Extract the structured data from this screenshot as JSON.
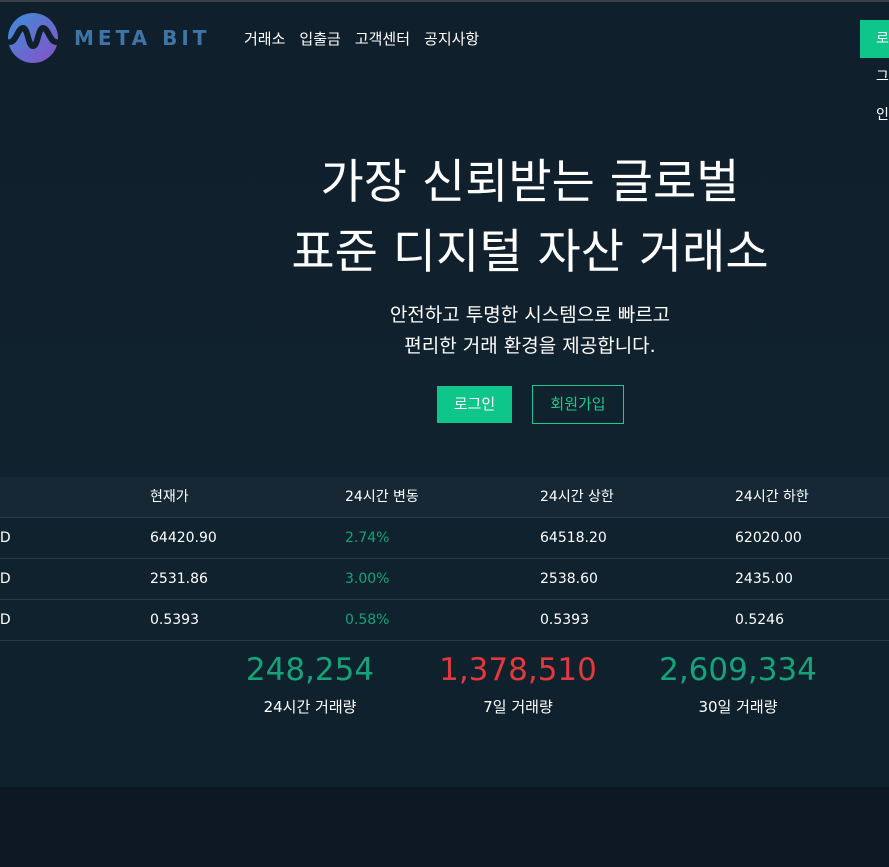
{
  "header": {
    "brand": "META BIT",
    "nav": [
      "거래소",
      "입출금",
      "고객센터",
      "공지사항"
    ],
    "right_button": "로그인"
  },
  "hero": {
    "headline": [
      "가장 신뢰받는 글로벌",
      "표준 디지털 자산 거래소"
    ],
    "subline": [
      "안전하고 투명한 시스템으로 빠르고",
      "편리한 거래 환경을 제공합니다."
    ],
    "login_label": "로그인",
    "signup_label": "회원가입"
  },
  "market": {
    "columns": [
      "",
      "현재가",
      "24시간 변동",
      "24시간 상한",
      "24시간 하한"
    ],
    "rows": [
      [
        "SD",
        "64420.90",
        "2.74%",
        "64518.20",
        "62020.00"
      ],
      [
        "SD",
        "2531.86",
        "3.00%",
        "2538.60",
        "2435.00"
      ],
      [
        "SD",
        "0.5393",
        "0.58%",
        "0.5393",
        "0.5246"
      ]
    ]
  },
  "stats": [
    {
      "value": "248,254",
      "label": "24시간 거래량",
      "color": "#16a37a"
    },
    {
      "value": "1,378,510",
      "label": "7일 거래량",
      "color": "#e0393e"
    },
    {
      "value": "2,609,334",
      "label": "30일 거래량",
      "color": "#16a37a"
    }
  ],
  "colors": {
    "accent": "#0fc68a",
    "positive": "#16a37a",
    "negative": "#e0393e",
    "background": "#0f1f2b"
  }
}
